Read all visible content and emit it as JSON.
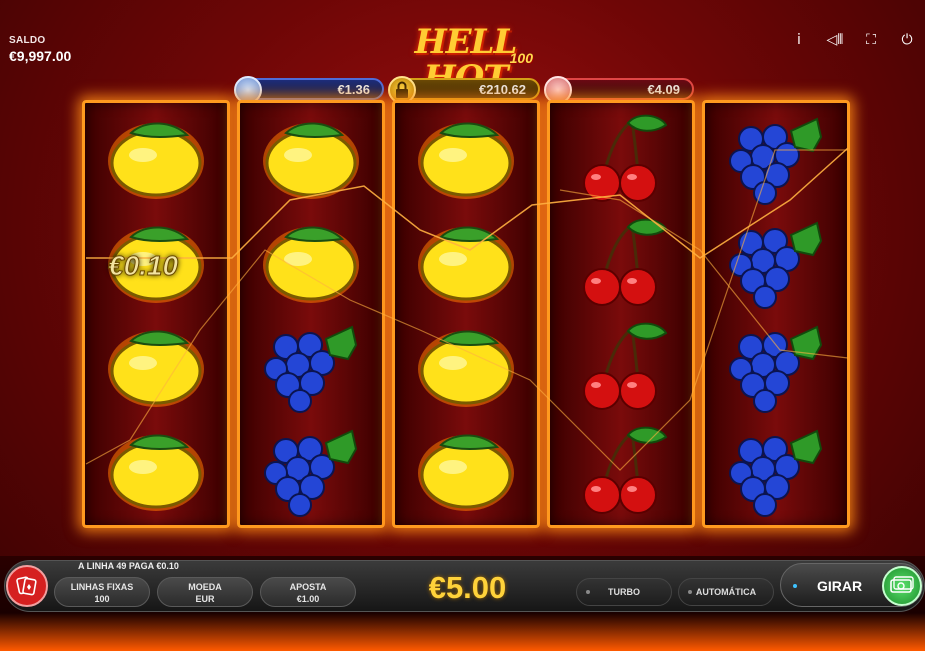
{
  "balance": {
    "label": "SALDO",
    "value": "€9,997.00"
  },
  "logo": {
    "title": "HELL HOT",
    "subtitle": "100"
  },
  "top_icons": [
    "info-icon",
    "sound-icon",
    "fullscreen-icon",
    "power-icon"
  ],
  "top_icon_glyphs": {
    "info": "i",
    "sound": "◁⦀",
    "fullscreen": "⛶",
    "power": "⏻"
  },
  "jackpots": [
    {
      "name": "blue",
      "value": "€1.36",
      "color": "#4f6cd8"
    },
    {
      "name": "gold",
      "value": "€210.62",
      "color": "#d4a017",
      "locked": true
    },
    {
      "name": "red",
      "value": "€4.09",
      "color": "#e04646"
    }
  ],
  "reels": [
    [
      "lemon",
      "lemon",
      "lemon",
      "lemon"
    ],
    [
      "lemon",
      "lemon",
      "grapes",
      "grapes"
    ],
    [
      "lemon",
      "lemon",
      "lemon",
      "lemon"
    ],
    [
      "cherry",
      "cherry",
      "cherry",
      "cherry"
    ],
    [
      "grapes",
      "grapes",
      "grapes",
      "grapes"
    ]
  ],
  "win_value": "€0.10",
  "message": "A LINHA 49 PAGA €0.10",
  "controls": {
    "lines": {
      "label": "LINHAS FIXAS",
      "value": "100"
    },
    "coin": {
      "label": "MOEDA",
      "value": "EUR"
    },
    "bet": {
      "label": "APOSTA",
      "value": "€1.00"
    },
    "total_bet": "€5.00",
    "turbo": "TURBO",
    "auto": "AUTOMÁTICA",
    "spin": "GIRAR"
  },
  "colors": {
    "accent": "#ffd23a",
    "reel_border": "#ff9a1f",
    "background": "#6e0606"
  }
}
